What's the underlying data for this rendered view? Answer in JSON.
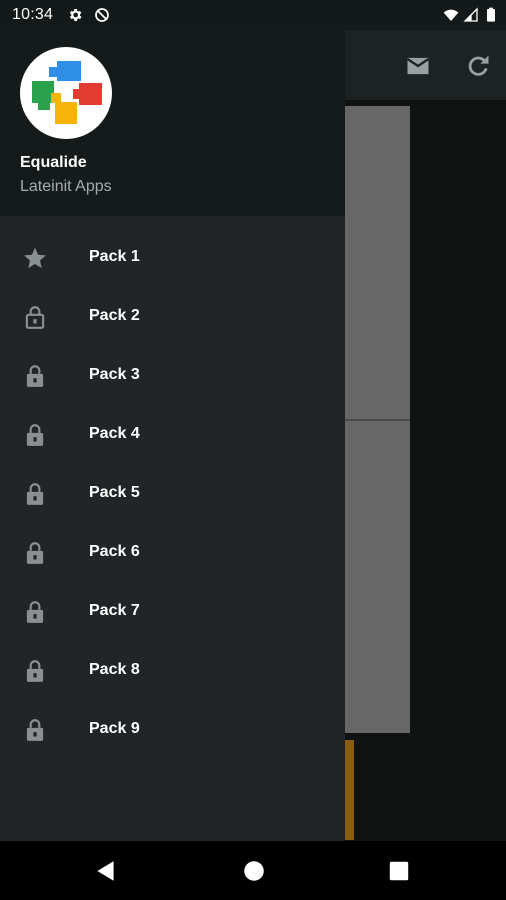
{
  "status_bar": {
    "time": "10:34",
    "icons": [
      "gear-icon",
      "do-not-disturb-icon",
      "wifi-icon",
      "cell-signal-icon",
      "battery-icon"
    ]
  },
  "toolbar": {
    "icons": [
      "mail-icon",
      "refresh-icon"
    ]
  },
  "drawer": {
    "app_name": "Equalide",
    "developer": "Lateinit Apps",
    "logo_colors": [
      "#2d8fe6",
      "#e23b32",
      "#2aa24c",
      "#f5b30c"
    ],
    "items": [
      {
        "label": "Pack 1",
        "icon": "star-icon"
      },
      {
        "label": "Pack 2",
        "icon": "lock-open-icon"
      },
      {
        "label": "Pack 3",
        "icon": "lock-icon"
      },
      {
        "label": "Pack 4",
        "icon": "lock-icon"
      },
      {
        "label": "Pack 5",
        "icon": "lock-icon"
      },
      {
        "label": "Pack 6",
        "icon": "lock-icon"
      },
      {
        "label": "Pack 7",
        "icon": "lock-icon"
      },
      {
        "label": "Pack 8",
        "icon": "lock-icon"
      },
      {
        "label": "Pack 9",
        "icon": "lock-icon"
      }
    ]
  },
  "nav_bar": {
    "icons": [
      "back-icon",
      "home-icon",
      "recents-icon"
    ]
  },
  "colors": {
    "drawer_bg": "#212527",
    "header_bg": "#151a1a",
    "icon_gray": "#8a8f90",
    "accent": "#8a5d12"
  }
}
